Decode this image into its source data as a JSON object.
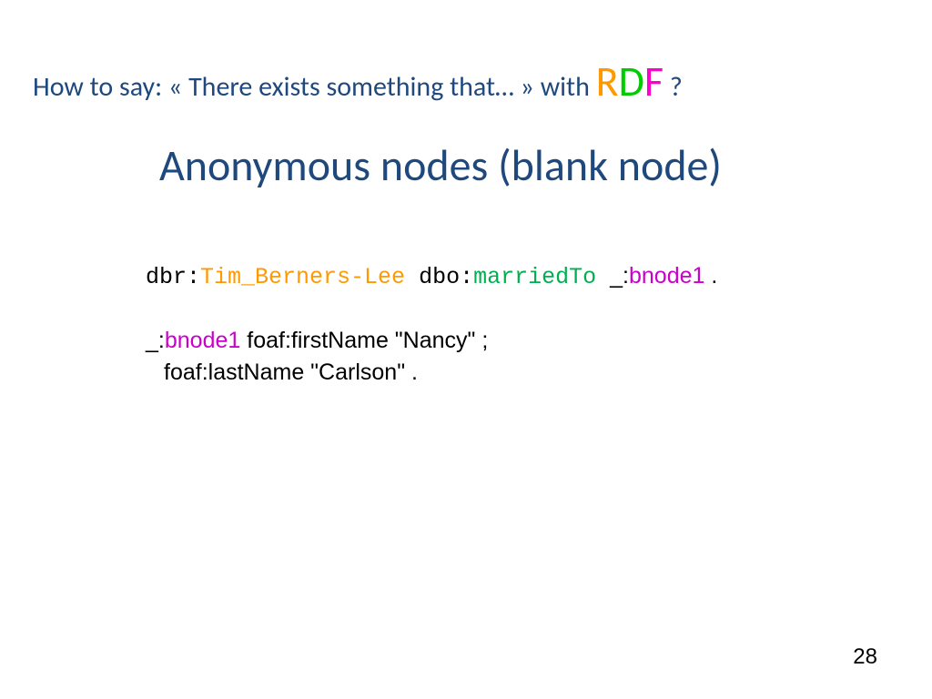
{
  "header": {
    "prefix": "How to say: « There exists something that… » with ",
    "rdf_r": "R",
    "rdf_d": "D",
    "rdf_f": "F",
    "suffix": " ?"
  },
  "title": "Anonymous nodes (blank node)",
  "code": {
    "line1": {
      "dbr": "dbr:",
      "tim": "Tim_Berners-Lee",
      "dbo": " dbo:",
      "married": "marriedTo",
      "space": "  ",
      "underscore": "_:",
      "bnode": "bnode1",
      "period": " ."
    },
    "line2": {
      "underscore": "_:",
      "bnode": "bnode1",
      "foaf": " foaf:firstName \"Nancy\" ;"
    },
    "line3": {
      "foaf": "foaf:lastName \"Carlson\" ."
    }
  },
  "page_number": "28"
}
